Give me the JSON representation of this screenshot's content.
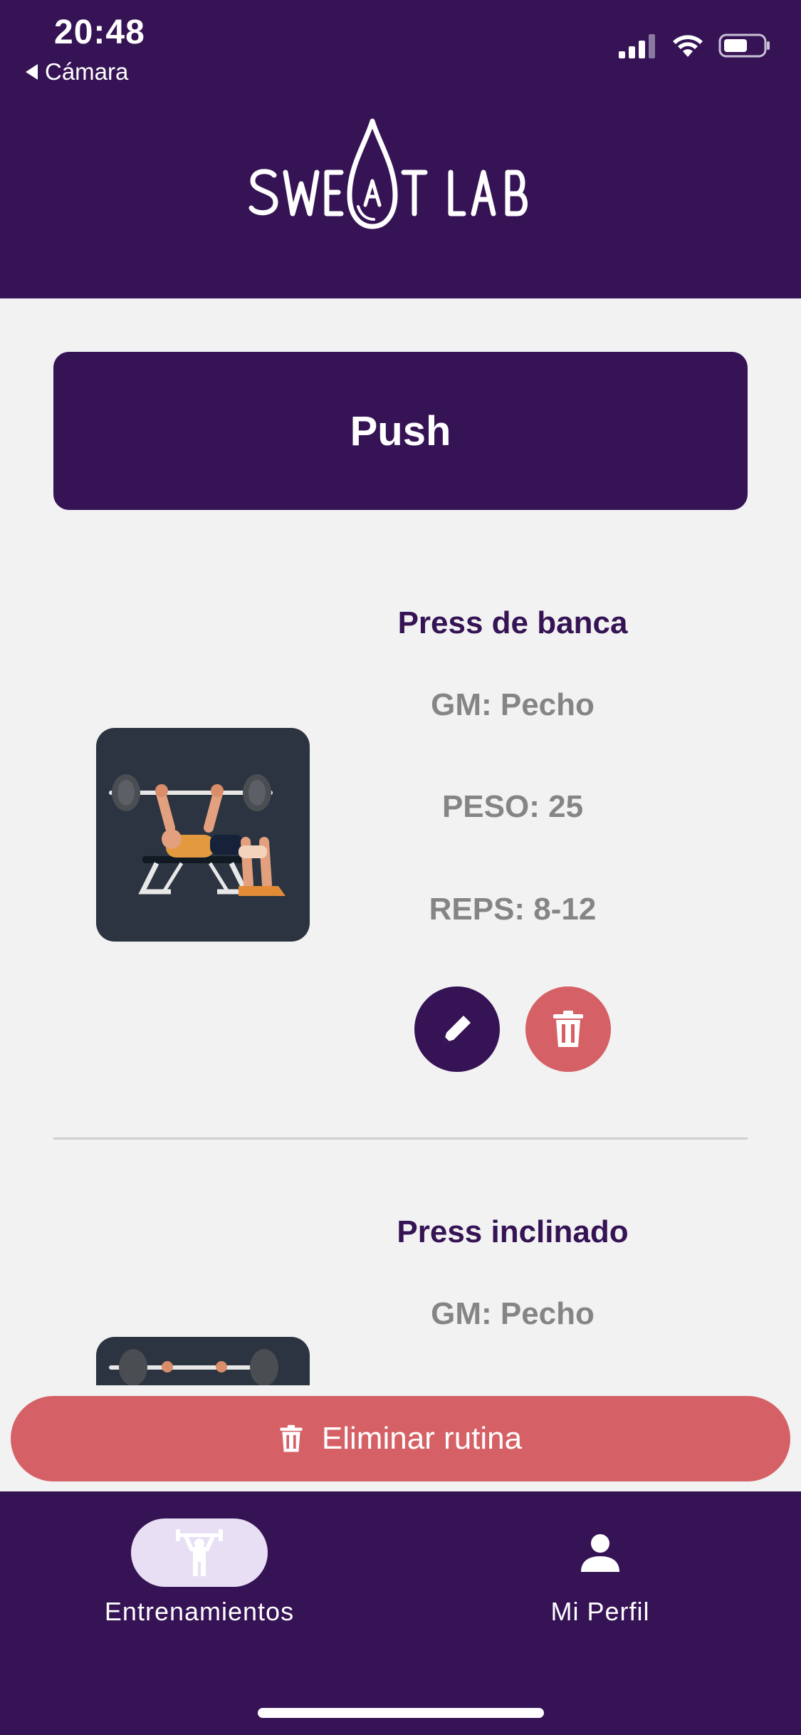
{
  "status_bar": {
    "time": "20:48",
    "back_label": "Cámara"
  },
  "header": {
    "logo_text": "SWEAT LAB"
  },
  "routine": {
    "title": "Push"
  },
  "exercises": [
    {
      "name": "Press de banca",
      "muscle_group": "GM: Pecho",
      "weight": "PESO: 25",
      "reps": "REPS: 8-12",
      "image_icon": "bench-press-illustration"
    },
    {
      "name": "Press inclinado",
      "muscle_group": "GM: Pecho",
      "image_icon": "bench-press-illustration"
    }
  ],
  "actions": {
    "delete_routine_label": "Eliminar rutina"
  },
  "nav": {
    "items": [
      {
        "label": "Entrenamientos",
        "icon": "weightlifter-icon",
        "active": true
      },
      {
        "label": "Mi Perfil",
        "icon": "person-icon",
        "active": false
      }
    ]
  },
  "colors": {
    "primary": "#351354",
    "danger": "#d56166",
    "background": "#f2f2f2",
    "muted_text": "#858585",
    "active_pill": "#e8dff5"
  }
}
